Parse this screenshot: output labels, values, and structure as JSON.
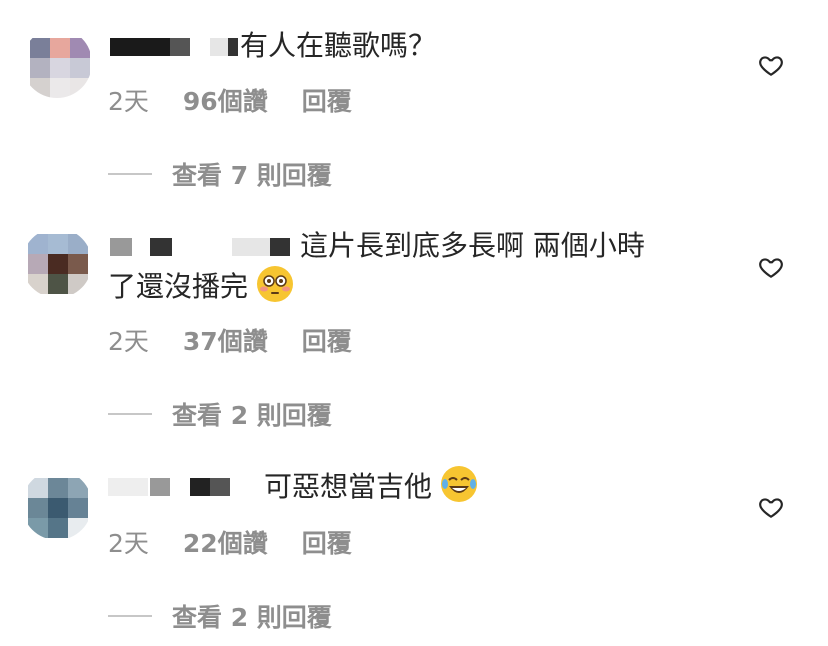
{
  "comments": [
    {
      "text": "有人在聽歌嗎？",
      "time": "2天",
      "likes": "96個讚",
      "reply_label": "回覆",
      "view_replies": "查看 7 則回覆"
    },
    {
      "text": "這片長到底多長啊 兩個小時",
      "text2": "了還沒播完",
      "emoji": "flushed-face",
      "time": "2天",
      "likes": "37個讚",
      "reply_label": "回覆",
      "view_replies": "查看 2 則回覆"
    },
    {
      "text": "可惡想當吉他",
      "emoji": "tears-of-joy-face",
      "time": "2天",
      "likes": "22個讚",
      "reply_label": "回覆",
      "view_replies": "查看 2 則回覆"
    }
  ]
}
